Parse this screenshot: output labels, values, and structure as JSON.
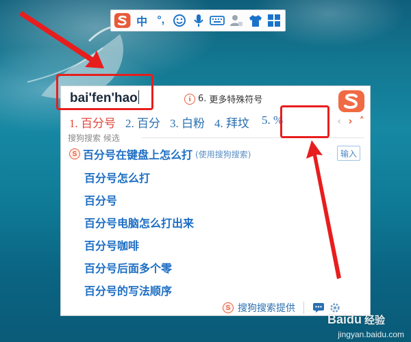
{
  "toolbar": {
    "items": [
      {
        "name": "lang-toggle",
        "label": "中"
      },
      {
        "name": "punct-toggle",
        "label": "°,"
      },
      {
        "name": "emoji-icon",
        "label": ""
      },
      {
        "name": "mic-icon",
        "label": ""
      },
      {
        "name": "keyboard-icon",
        "label": ""
      },
      {
        "name": "user-icon",
        "label": ""
      },
      {
        "name": "skin-icon",
        "label": ""
      },
      {
        "name": "toolbox-icon",
        "label": ""
      }
    ]
  },
  "candidate_window": {
    "pinyin": "bai'fen'hao",
    "tip_number": "6.",
    "tip_text": "更多特殊符号",
    "candidates": [
      "1. 百分号",
      "2. 百分",
      "3. 白粉",
      "4. 拜坟",
      "5. %"
    ],
    "section_label": "搜狗搜索 候选",
    "first_suggestion": "百分号在键盘上怎么打",
    "first_suggestion_note": "(使用搜狗搜索)",
    "input_button": "输入",
    "suggestions": [
      "百分号怎么打",
      "百分号",
      "百分号电脑怎么打出来",
      "百分号咖啡",
      "百分号后面多个零",
      "百分号的写法顺序"
    ],
    "footer_text": "搜狗搜索提供"
  },
  "watermark": {
    "brand": "Baidu",
    "suffix": "经验",
    "url": "jingyan.baidu.com"
  },
  "colors": {
    "accent_red": "#e81d1d",
    "candidate_blue": "#2a6fb0",
    "active_red": "#e0453a",
    "sogou_orange": "#e85a3a"
  }
}
